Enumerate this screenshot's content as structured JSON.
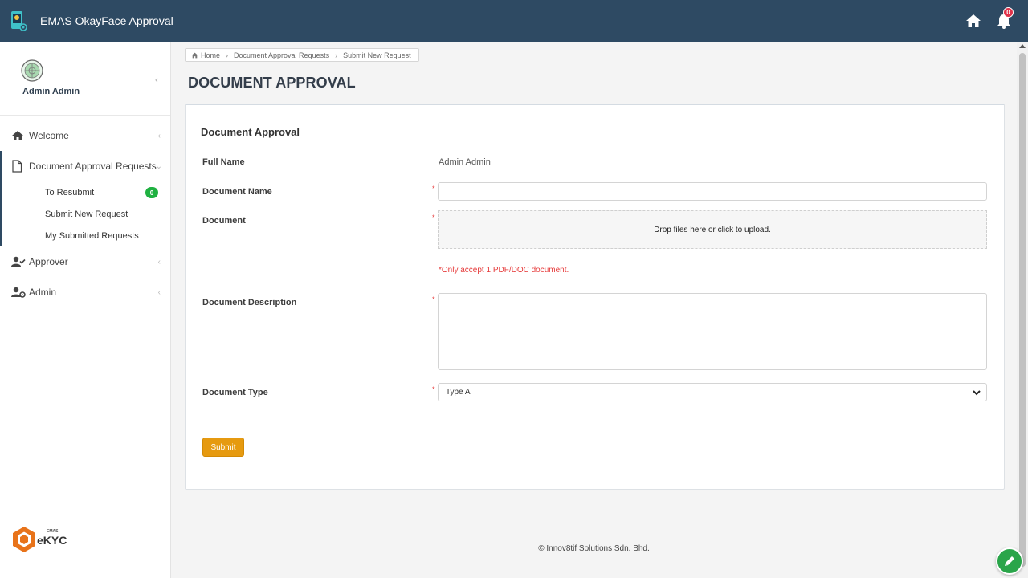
{
  "app": {
    "title": "EMAS OkayFace Approval",
    "accent": "#2e4a63",
    "notification_count": "0"
  },
  "sidebar": {
    "user_name": "Admin Admin",
    "items": [
      {
        "label": "Welcome",
        "icon": "home-icon"
      },
      {
        "label": "Document Approval Requests",
        "icon": "file-icon"
      },
      {
        "label": "Approver",
        "icon": "user-check-icon"
      },
      {
        "label": "Admin",
        "icon": "user-gear-icon"
      }
    ],
    "sub_items": [
      {
        "label": "To Resubmit",
        "badge": "0"
      },
      {
        "label": "Submit New Request"
      },
      {
        "label": "My Submitted Requests"
      }
    ],
    "logo_text": "eKYC"
  },
  "breadcrumb": {
    "home": "Home",
    "level1": "Document Approval Requests",
    "level2": "Submit New Request"
  },
  "page": {
    "title": "DOCUMENT APPROVAL"
  },
  "form": {
    "card_title": "Document Approval",
    "full_name_label": "Full Name",
    "full_name_value": "Admin Admin",
    "document_name_label": "Document Name",
    "document_name_value": "",
    "document_label": "Document",
    "dropzone_text": "Drop files here or click to upload.",
    "document_hint": "*Only accept 1 PDF/DOC document.",
    "description_label": "Document Description",
    "description_value": "",
    "type_label": "Document Type",
    "type_value": "Type A",
    "required_mark": "*",
    "submit_label": "Submit",
    "submit_color": "#e69a10"
  },
  "footer": {
    "text": "© Innov8tif Solutions Sdn. Bhd."
  }
}
